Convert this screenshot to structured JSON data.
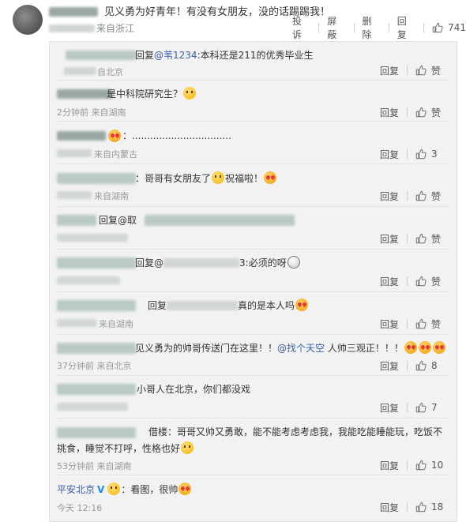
{
  "main": {
    "text": "见义勇为好青年！有没有女朋友，没的话踢踢我！",
    "meta_source": "来自浙江",
    "actions": {
      "report": "投诉",
      "block": "屏蔽",
      "delete": "删除",
      "reply": "回复"
    },
    "likes": "741"
  },
  "replies": [
    {
      "text_prefix": "回复",
      "mention": "@苇1234",
      "text_suffix": ":本科还是211的优秀毕业生",
      "meta": "自北京",
      "reply": "回复",
      "likes": "赞"
    },
    {
      "text": "是中科院研究生？",
      "meta": "2分钟前 来自湖南",
      "reply": "回复",
      "likes": "赞"
    },
    {
      "text": "：.................................",
      "meta": "来自内蒙古",
      "reply": "回复",
      "likes": "3"
    },
    {
      "text_a": "：哥哥有女朋友了",
      "text_b": "祝福啦！",
      "meta": "来自湖南",
      "reply": "回复",
      "likes": "赞"
    },
    {
      "text": "回复@取",
      "meta": "",
      "reply": "回复",
      "likes": "赞"
    },
    {
      "text_a": "回复@",
      "text_b": "3:必须的呀",
      "meta": "",
      "reply": "回复",
      "likes": "赞"
    },
    {
      "text_a": "回复",
      "text_b": "真的是本人吗",
      "meta": "来自湖南",
      "reply": "回复",
      "likes": "赞"
    },
    {
      "text_a": "见义勇为的帅哥传送门在这里！！",
      "mention": "@找个天空",
      "text_b": " 人帅三观正！！！",
      "meta": "37分钟前 来自北京",
      "reply": "回复",
      "likes": "8"
    },
    {
      "text": "小哥人在北京，你们都没戏",
      "meta": "",
      "reply": "回复",
      "likes": "7"
    },
    {
      "line1": "借楼：哥哥又帅又勇敢，能不能考虑考虑我，我能吃能睡能玩，吃饭不",
      "line2": "挑食，睡觉不打呼，性格也好",
      "meta": "53分钟前 来自湖南",
      "reply": "回复",
      "likes": "10"
    },
    {
      "user": "平安北京",
      "text": "：看图，很帅",
      "meta": "今天 12:16",
      "reply": "回复",
      "likes": "18"
    }
  ],
  "colors": {
    "link": "#3a5ea8",
    "meta": "#999999",
    "panel": "#f2f2f2"
  },
  "icons": [
    "thumbs-up-icon",
    "vip-badge-icon",
    "emoji-icon"
  ]
}
